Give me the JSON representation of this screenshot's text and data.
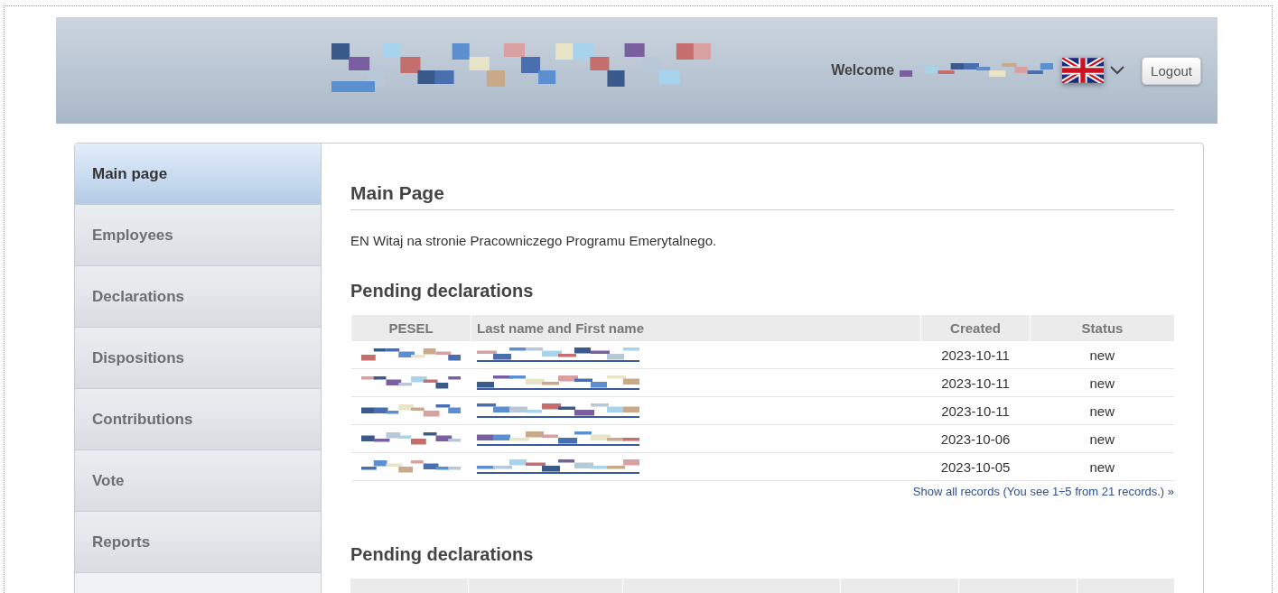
{
  "header": {
    "welcome": "Welcome",
    "logout": "Logout"
  },
  "sidebar": {
    "items": [
      {
        "label": "Main page",
        "selected": true
      },
      {
        "label": "Employees",
        "selected": false
      },
      {
        "label": "Declarations",
        "selected": false
      },
      {
        "label": "Dispositions",
        "selected": false
      },
      {
        "label": "Contributions",
        "selected": false
      },
      {
        "label": "Vote",
        "selected": false
      },
      {
        "label": "Reports",
        "selected": false
      }
    ]
  },
  "main": {
    "title": "Main Page",
    "intro": "EN Witaj na stronie Pracowniczego Programu Emerytalnego.",
    "sections": [
      {
        "title": "Pending declarations",
        "columns": [
          "PESEL",
          "Last name and First name",
          "Created",
          "Status"
        ],
        "rows": [
          {
            "created": "2023-10-11",
            "status": "new"
          },
          {
            "created": "2023-10-11",
            "status": "new"
          },
          {
            "created": "2023-10-11",
            "status": "new"
          },
          {
            "created": "2023-10-06",
            "status": "new"
          },
          {
            "created": "2023-10-05",
            "status": "new"
          }
        ],
        "footer_link": "Show all records (You see 1÷5 from 21 records.) »"
      },
      {
        "title": "Pending declarations"
      }
    ]
  }
}
